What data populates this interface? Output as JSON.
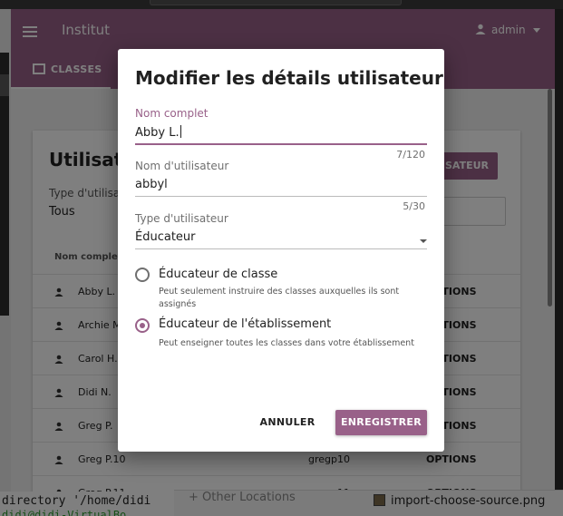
{
  "window": {
    "app_title": "Institut",
    "user": "admin"
  },
  "nav": {
    "tab_classes": "CLASSES"
  },
  "background_page": {
    "title": "Utilisat",
    "new_user_button": "ISATEUR",
    "filter_label": "Type d'utilisa",
    "filter_value": "Tous",
    "column_full_name": "Nom complet",
    "rows": [
      {
        "name": "Abby L.",
        "username": "",
        "options": "OPTIONS"
      },
      {
        "name": "Archie M",
        "username": "",
        "options": "OPTIONS"
      },
      {
        "name": "Carol H.",
        "username": "",
        "options": "OPTIONS"
      },
      {
        "name": "Didi N.",
        "username": "",
        "options": "OPTIONS"
      },
      {
        "name": "Greg P.",
        "username": "",
        "options": "OPTIONS"
      },
      {
        "name": "Greg P.10",
        "username": "gregp10",
        "options": "OPTIONS"
      },
      {
        "name": "Greg P.11",
        "username": "gregp11",
        "options": "OPTIONS"
      }
    ]
  },
  "desktop": {
    "terminal_line_1": "directory '/home/didi",
    "terminal_line_2": "didi@didi-VirtualBo",
    "files_location": "+ Other Locations",
    "file_name": "import-choose-source.png"
  },
  "modal": {
    "title": "Modifier les détails utilisateur",
    "full_name": {
      "label": "Nom complet",
      "value": "Abby L.",
      "counter": "7/120"
    },
    "username": {
      "label": "Nom d'utilisateur",
      "value": "abbyl",
      "counter": "5/30"
    },
    "user_type": {
      "label": "Type d'utilisateur",
      "value": "Éducateur"
    },
    "options": [
      {
        "label": "Éducateur de classe",
        "desc": "Peut seulement instruire des classes auxquelles ils sont assignés",
        "checked": false
      },
      {
        "label": "Éducateur de l'établissement",
        "desc": "Peut enseigner toutes les classes dans votre établissement",
        "checked": true
      }
    ],
    "cancel_label": "ANNULER",
    "save_label": "ENREGISTRER"
  },
  "colors": {
    "accent": "#996189",
    "overlay": "rgba(0,0,0,0.5)"
  },
  "icons": [
    "menu-icon",
    "account-icon",
    "classes-icon",
    "person-icon",
    "dropdown-arrow-icon",
    "file-image-icon"
  ]
}
